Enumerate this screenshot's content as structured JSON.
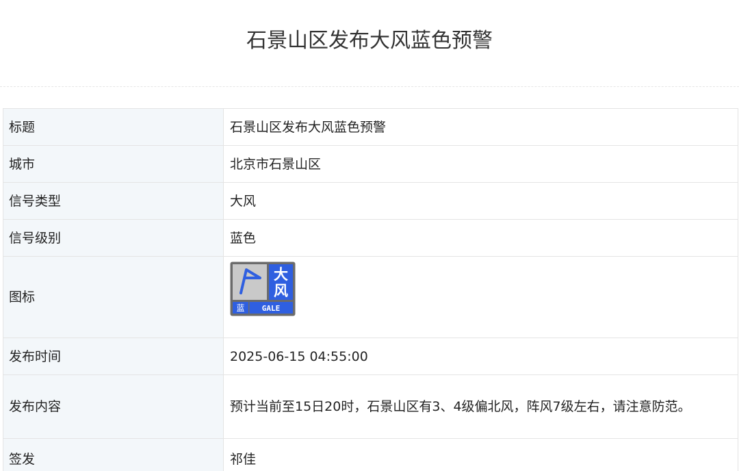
{
  "page": {
    "title": "石景山区发布大风蓝色预警"
  },
  "table": {
    "rows": [
      {
        "label": "标题",
        "value": "石景山区发布大风蓝色预警"
      },
      {
        "label": "城市",
        "value": "北京市石景山区"
      },
      {
        "label": "信号类型",
        "value": "大风"
      },
      {
        "label": "信号级别",
        "value": "蓝色"
      },
      {
        "label": "图标",
        "icon": "gale-blue-warning-icon"
      },
      {
        "label": "发布时间",
        "value": "2025-06-15 04:55:00"
      },
      {
        "label": "发布内容",
        "value": "预计当前至15日20时，石景山区有3、4级偏北风，阵风7级左右，请注意防范。"
      },
      {
        "label": "签发",
        "value": "祁佳"
      }
    ]
  },
  "badge": {
    "top_char": "大",
    "bottom_char": "风",
    "level_char": "蓝",
    "english": "GALE"
  },
  "colors": {
    "label_background": "#f3f7fa",
    "border": "#e4e4e4",
    "warning_blue": "#2f5fe0",
    "badge_frame": "#6b6b6b"
  }
}
